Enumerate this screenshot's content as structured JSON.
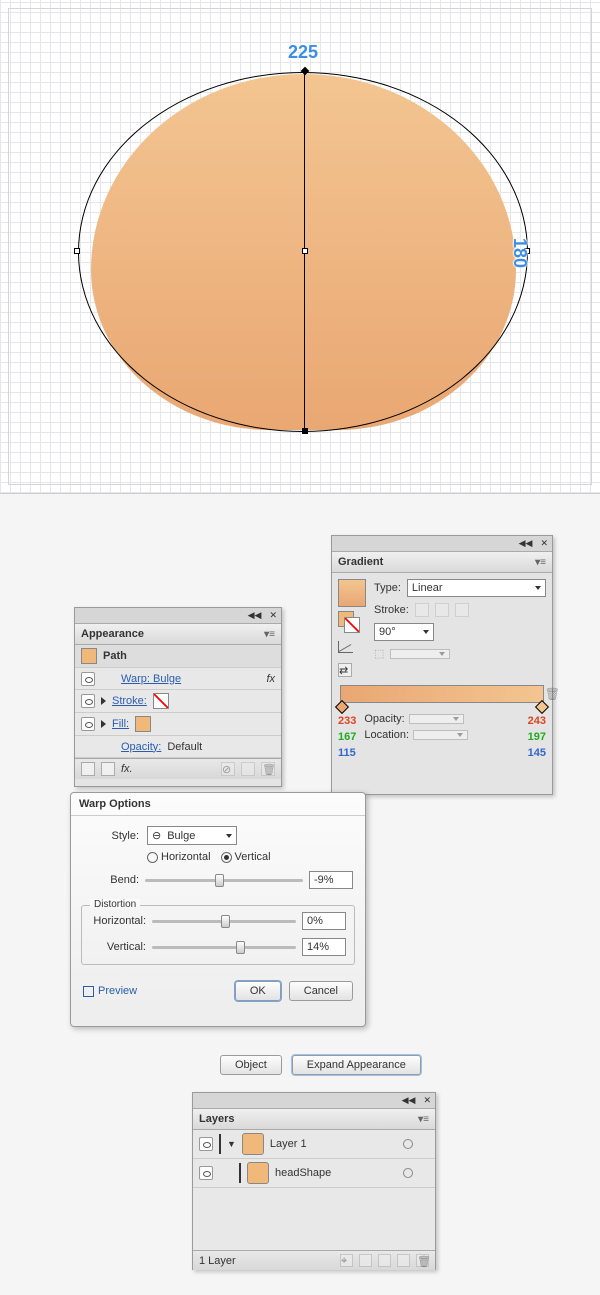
{
  "canvas": {
    "width_label": "225",
    "height_label": "180"
  },
  "appearance": {
    "title": "Appearance",
    "item": "Path",
    "warp": "Warp: Bulge",
    "fx": "fx",
    "stroke": "Stroke:",
    "fill": "Fill:",
    "opacity": "Opacity:",
    "opacity_val": "Default",
    "fx_menu": "fx."
  },
  "gradient": {
    "title": "Gradient",
    "type_label": "Type:",
    "type_value": "Linear",
    "stroke_label": "Stroke:",
    "angle": "90°",
    "opacity_label": "Opacity:",
    "location_label": "Location:",
    "left": {
      "r": "233",
      "g": "167",
      "b": "115"
    },
    "right": {
      "r": "243",
      "g": "197",
      "b": "145"
    }
  },
  "warp": {
    "title": "Warp Options",
    "style_label": "Style:",
    "style_value": "Bulge",
    "horiz_opt": "Horizontal",
    "vert_opt": "Vertical",
    "bend_label": "Bend:",
    "bend_value": "-9%",
    "distortion": "Distortion",
    "dh_label": "Horizontal:",
    "dh_value": "0%",
    "dv_label": "Vertical:",
    "dv_value": "14%",
    "preview": "Preview",
    "ok": "OK",
    "cancel": "Cancel"
  },
  "buttons": {
    "object": "Object",
    "expand": "Expand Appearance"
  },
  "layers": {
    "title": "Layers",
    "layer1": "Layer 1",
    "head": "headShape",
    "footer": "1 Layer"
  }
}
